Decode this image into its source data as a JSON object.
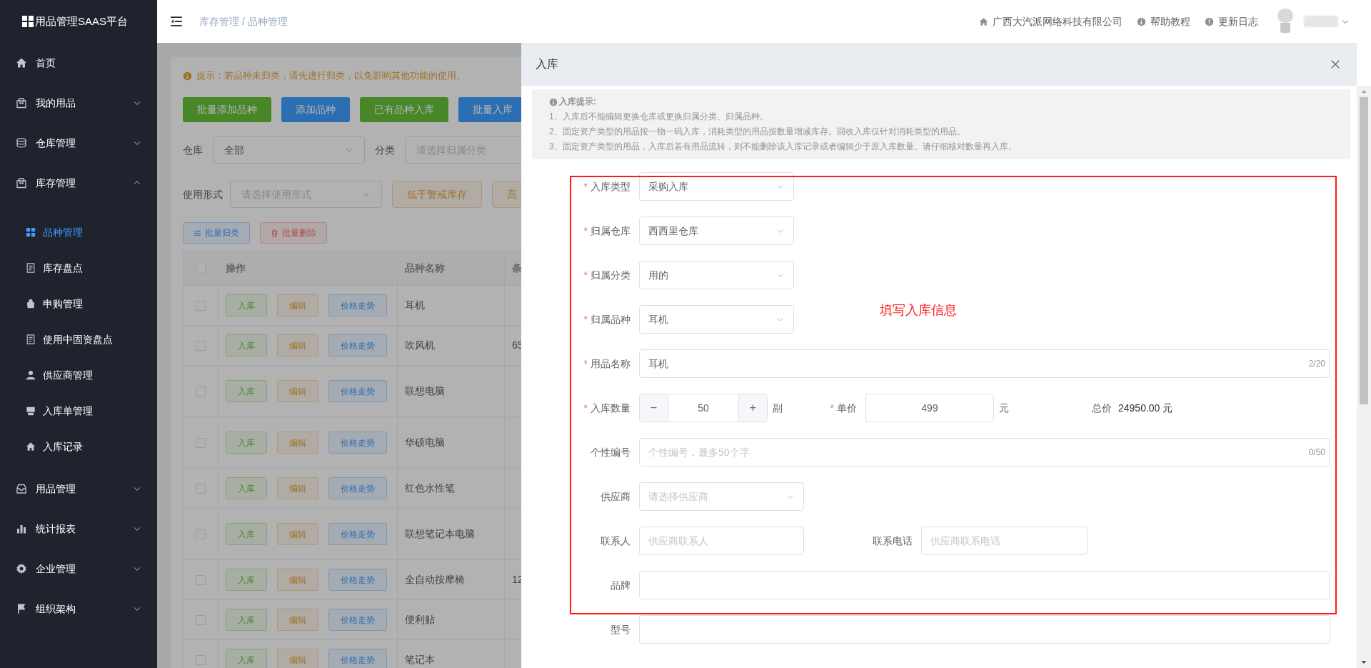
{
  "sidebar": {
    "logo": "用品管理SAAS平台",
    "items": [
      {
        "kind": "link",
        "label": "首页"
      },
      {
        "kind": "group",
        "label": "我的用品",
        "expanded": false
      },
      {
        "kind": "group",
        "label": "仓库管理",
        "expanded": false
      },
      {
        "kind": "group",
        "label": "库存管理",
        "expanded": true,
        "children": [
          {
            "label": "品种管理",
            "selected": true
          },
          {
            "label": "库存盘点",
            "selected": false
          },
          {
            "label": "申购管理",
            "selected": false
          },
          {
            "label": "使用中固资盘点",
            "selected": false
          },
          {
            "label": "供应商管理",
            "selected": false
          },
          {
            "label": "入库单管理",
            "selected": false
          },
          {
            "label": "入库记录",
            "selected": false
          }
        ]
      },
      {
        "kind": "group",
        "label": "用品管理",
        "expanded": false
      },
      {
        "kind": "group",
        "label": "统计报表",
        "expanded": false
      },
      {
        "kind": "group",
        "label": "企业管理",
        "expanded": false
      },
      {
        "kind": "group",
        "label": "组织架构",
        "expanded": false
      }
    ]
  },
  "header": {
    "breadcrumb": "库存管理 / 品种管理",
    "links": [
      "广西大汽派网络科技有限公司",
      "帮助教程",
      "更新日志"
    ]
  },
  "main": {
    "notice": "提示：若品种未归类，请先进行归类，以免影响其他功能的使用。",
    "buttons": [
      {
        "label": "批量添加品种",
        "kind": "success"
      },
      {
        "label": "添加品种",
        "kind": "primary"
      },
      {
        "label": "已有品种入库",
        "kind": "success"
      },
      {
        "label": "批量入库",
        "kind": "primary"
      }
    ],
    "filters": [
      {
        "label": "仓库",
        "value": "全部"
      },
      {
        "label": "分类",
        "placeholder": "请选择归属分类"
      },
      {
        "label": "使用形式",
        "placeholder": "请选择使用形式"
      }
    ],
    "stock_buttons": [
      "低于警戒库存",
      "高"
    ],
    "batch_buttons": [
      {
        "label": "批量归类",
        "kind": "primary"
      },
      {
        "label": "批量删除",
        "kind": "danger"
      }
    ],
    "table": {
      "header_checked": false,
      "columns": [
        "操作",
        "品种名称",
        "条"
      ],
      "rows": [
        {
          "checked": false,
          "actions": [
            "入库",
            "编辑",
            "价格走势"
          ],
          "name": "耳机"
        },
        {
          "checked": false,
          "actions": [
            "入库",
            "编辑",
            "价格走势"
          ],
          "name": "吹风机",
          "column_3": "65"
        },
        {
          "checked": false,
          "actions": [
            "入库",
            "编辑",
            "价格走势"
          ],
          "name": "联想电脑"
        },
        {
          "checked": false,
          "actions": [
            "入库",
            "编辑",
            "价格走势"
          ],
          "name": "华硕电脑"
        },
        {
          "checked": false,
          "actions": [
            "入库",
            "编辑",
            "价格走势"
          ],
          "name": "红色水性笔"
        },
        {
          "checked": false,
          "actions": [
            "入库",
            "编辑",
            "价格走势"
          ],
          "name": "联想笔记本电脑"
        },
        {
          "checked": false,
          "actions": [
            "入库",
            "编辑",
            "价格走势"
          ],
          "name": "全自动按摩椅",
          "column_3": "12"
        },
        {
          "checked": false,
          "actions": [
            "入库",
            "编辑",
            "价格走势"
          ],
          "name": "便利贴"
        },
        {
          "checked": false,
          "actions": [
            "入库",
            "编辑",
            "价格走势"
          ],
          "name": "笔记本"
        }
      ]
    }
  },
  "drawer": {
    "title": "入库",
    "tips": {
      "title": "入库提示:",
      "lines": [
        "1、入库后不能编辑更换仓库或更换归属分类、归属品种。",
        "2、固定资产类型的用品按一物一码入库，消耗类型的用品按数量增减库存。回收入库仅针对消耗类型的用品。",
        "3、固定资产类型的用品，入库后若有用品流转，则不能删除该入库记录或者编辑少于原入库数量。请仔细核对数量再入库。"
      ]
    },
    "annotation": "填写入库信息",
    "form": [
      {
        "kind": "select",
        "label": "入库类型",
        "required": "*",
        "value": "采购入库"
      },
      {
        "kind": "select",
        "label": "归属仓库",
        "required": "*",
        "value": "西西里仓库"
      },
      {
        "kind": "select",
        "label": "归属分类",
        "required": "*",
        "value": "用的"
      },
      {
        "kind": "select",
        "label": "归属品种",
        "required": "*",
        "value": "耳机"
      },
      {
        "kind": "input",
        "label": "用品名称",
        "required": "*",
        "value": "耳机",
        "counter": "2/20"
      },
      {
        "kind": "quantity",
        "label": "入库数量",
        "required": "*",
        "minus": "−",
        "value": "50",
        "plus": "+",
        "unit": "副",
        "price_label": "单价",
        "price_required": "*",
        "price": "499",
        "price_unit": "元",
        "total_label": "总价",
        "total": "24950.00 元"
      },
      {
        "kind": "input",
        "label": "个性编号",
        "placeholder": "个性编号，最多50个字",
        "counter": "0/50"
      },
      {
        "kind": "select",
        "label": "供应商",
        "placeholder": "请选择供应商"
      },
      {
        "kind": "pair",
        "label": "联系人",
        "placeholder": "供应商联系人",
        "label_2": "联系电话",
        "placeholder_2": "供应商联系电话"
      },
      {
        "kind": "input",
        "label": "品牌"
      },
      {
        "kind": "input",
        "label": "型号"
      }
    ]
  }
}
